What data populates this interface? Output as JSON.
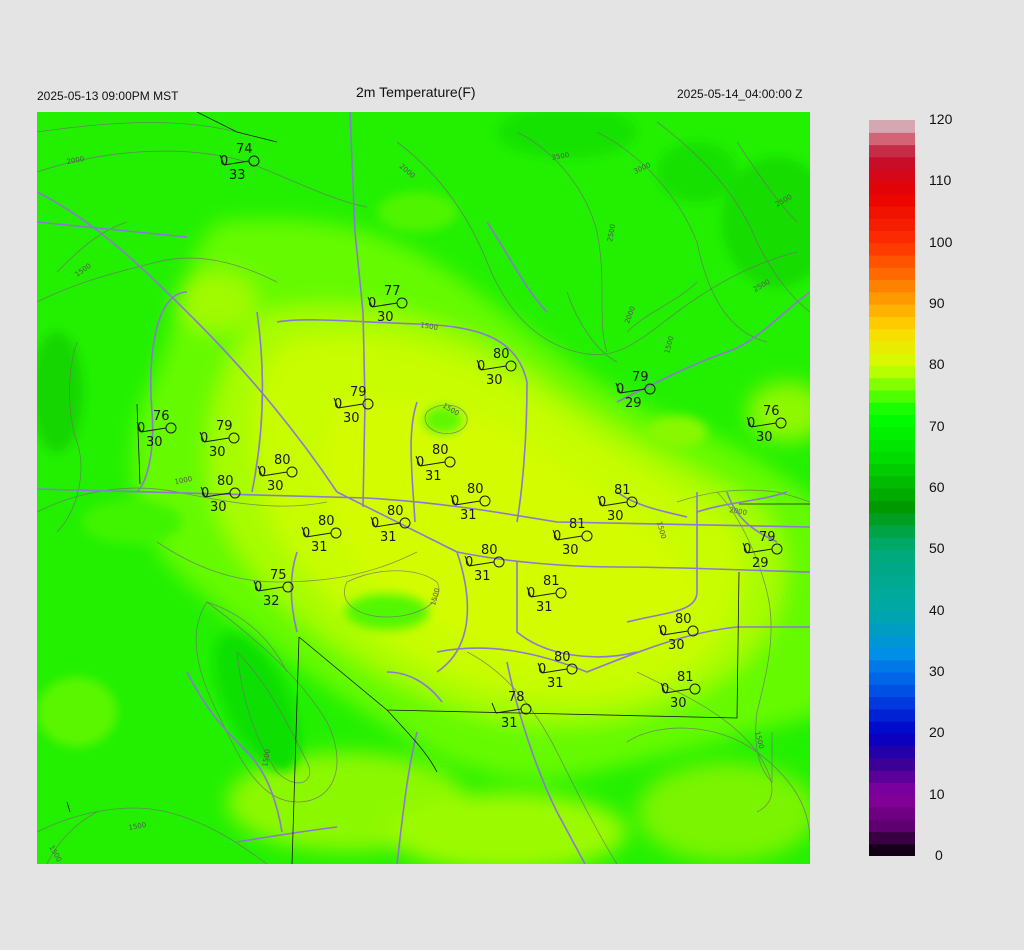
{
  "header": {
    "left_timestamp": "2025-05-13 09:00PM MST",
    "title": "2m Temperature(F)",
    "right_timestamp": "2025-05-14_04:00:00 Z"
  },
  "colorbar": {
    "labels": [
      "120",
      "110",
      "100",
      "90",
      "80",
      "70",
      "60",
      "50",
      "40",
      "30",
      "20",
      "10",
      "0"
    ],
    "stops": [
      {
        "v": 0,
        "color": "#000000"
      },
      {
        "v": 5,
        "color": "#5e0070"
      },
      {
        "v": 10,
        "color": "#8a00a0"
      },
      {
        "v": 15,
        "color": "#3c0096"
      },
      {
        "v": 20,
        "color": "#0000c8"
      },
      {
        "v": 27,
        "color": "#0050e6"
      },
      {
        "v": 33,
        "color": "#008ee6"
      },
      {
        "v": 40,
        "color": "#00a8a8"
      },
      {
        "v": 50,
        "color": "#00aa78"
      },
      {
        "v": 57,
        "color": "#009a00"
      },
      {
        "v": 65,
        "color": "#00dc00"
      },
      {
        "v": 72,
        "color": "#00ff00"
      },
      {
        "v": 80,
        "color": "#d0ff00"
      },
      {
        "v": 86,
        "color": "#ffd800"
      },
      {
        "v": 92,
        "color": "#ff8c00"
      },
      {
        "v": 100,
        "color": "#ff3000"
      },
      {
        "v": 108,
        "color": "#e80000"
      },
      {
        "v": 114,
        "color": "#c01030"
      },
      {
        "v": 118,
        "color": "#d88090"
      },
      {
        "v": 120,
        "color": "#d0d0d0"
      }
    ]
  },
  "contour_labels": [
    "2000",
    "2000",
    "1500",
    "3500",
    "3000",
    "2500",
    "2000",
    "2500",
    "2000",
    "1500",
    "1500",
    "1500",
    "1000",
    "1500",
    "2000",
    "1500",
    "1500",
    "1500",
    "1500",
    "1500",
    "1500",
    "2500"
  ],
  "stations": [
    {
      "t": "74",
      "w": "33",
      "d": "0"
    },
    {
      "t": "77",
      "w": "30",
      "d": "0"
    },
    {
      "t": "80",
      "w": "30",
      "d": "0"
    },
    {
      "t": "79",
      "w": "29",
      "d": "0"
    },
    {
      "t": "79",
      "w": "30",
      "d": "0"
    },
    {
      "t": "76",
      "w": "30",
      "d": "0"
    },
    {
      "t": "79",
      "w": "30",
      "d": "0"
    },
    {
      "t": "80",
      "w": "31",
      "d": "0"
    },
    {
      "t": "76",
      "w": "30",
      "d": "0"
    },
    {
      "t": "80",
      "w": "30",
      "d": "0"
    },
    {
      "t": "80",
      "w": "30",
      "d": "0"
    },
    {
      "t": "80",
      "w": "31",
      "d": "0"
    },
    {
      "t": "81",
      "w": "30",
      "d": "0"
    },
    {
      "t": "80",
      "w": "31",
      "d": "0"
    },
    {
      "t": "80",
      "w": "31",
      "d": "0"
    },
    {
      "t": "81",
      "w": "30",
      "d": "0"
    },
    {
      "t": "79",
      "w": "29",
      "d": "0"
    },
    {
      "t": "80",
      "w": "31",
      "d": "0"
    },
    {
      "t": "75",
      "w": "32",
      "d": "0"
    },
    {
      "t": "81",
      "w": "31",
      "d": "0"
    },
    {
      "t": "80",
      "w": "30",
      "d": "0"
    },
    {
      "t": "80",
      "w": "31",
      "d": "0"
    },
    {
      "t": "81",
      "w": "30",
      "d": "0"
    },
    {
      "t": "78",
      "w": "31",
      "d": ""
    }
  ]
}
